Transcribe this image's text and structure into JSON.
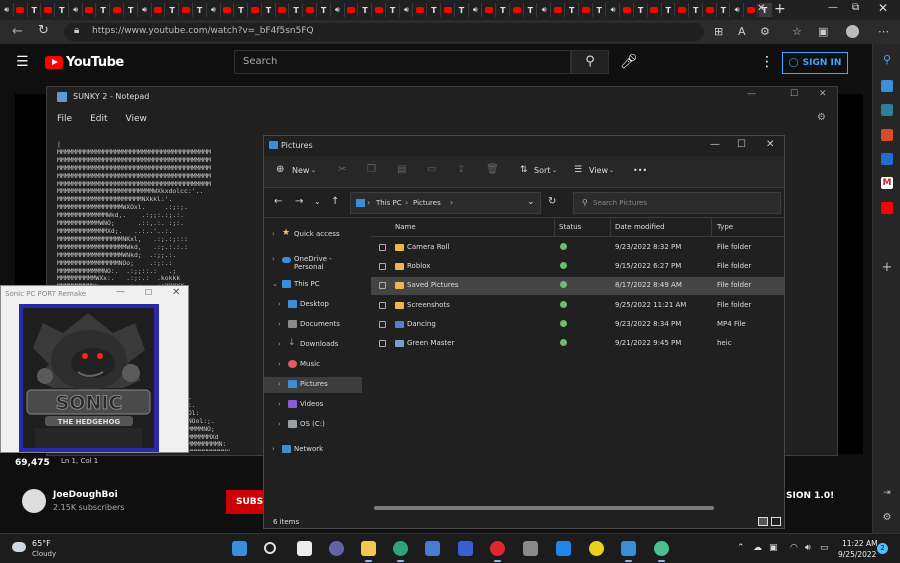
{
  "browser": {
    "tab_close": "✕",
    "url": "https://www.youtube.com/watch?v=_bF4f5sn5FQ"
  },
  "youtube": {
    "logo_text": "YouTube",
    "search_placeholder": "Search",
    "signin_label": "SIGN IN",
    "views": "69,475",
    "channel_name": "JoeDoughBoi",
    "channel_subs": "2.15K subscribers",
    "subscribe_label": "SUBSC",
    "version_text": "SION 1.0!"
  },
  "notepad": {
    "title": "SUNKY 2 - Notepad",
    "menu": [
      "File",
      "Edit",
      "View"
    ],
    "status": "Ln 1, Col 1",
    "content_lines": [
      "|",
      "MMMMMMMMMMMMMMMMMMMMMMMMMMMMMMMMMMMMMMMM",
      "MMMMMMMMMMMMMMMMMMMMMMMMMMMMMMMMMMMMMMMM",
      "MMMMMMMMMMMMMMMMMMMMMMMMMMMMMMMMMMMMMMMM",
      "MMMMMMMMMMMMMMMMMMMMMMMMMMMMMMMMMMMMMMMM",
      "MMMMMMMMMMMMMMMMMMMMMMMMMMMMMMMMMMMMMMMM",
      "MMMMMMMMMMMMMMMMMMMMMMMMMWXkxdolcc:'..",
      "MMMMMMMMMMMMMMMMMMMMMMNXkkl:'.",
      "MMMMMMMMMMMMMMMMMWXOxl.     .:;:;.",
      "MMMMMMMMMMMMMWkd,.    .:;;:.:;.:.",
      "MMMMMMMMMMMWNO;      .::,.:. :;:.",
      "MMMMMMMMMMMMMXd;.   ..:..'..:.",
      "MMMMMMMMMMMMMMMMMNKxl,   .:;.:;:::",
      "MMMMMMMMMMMMMMMMMMWkd,   .:;.:.:.:",
      "MMMMMMMMMMMMMMMMMWNkd;  .:;;.:.",
      "MMMMMMMMMMMMMMMMNOo;    .:;:.:",
      "MMMMMMMMMMMMNO:.  .:;;::.:   .;",
      "MMMMMMMMMMWXx:.   .:;:.:  .kokkk",
      "MMMMMMMMMWx..     .:;:.  .:oXXXXX",
      "MMMMMMMMWk.    .;::;:.  .oOXXXXX",
      "MMMMMMMMMO.   .::;:.    ..oOKXX",
      "MMMMMMMMMMXx.  .:.:.      .oOX",
      "MMMMMMMMMMMNO,  .:;,  ;:.   ..",
      "MMMMMMMMMMMMMWk..:;.:. ..",
      "MMMMMMMMMMMMMMMNx,.:.;.",
      "MMMMMMMMMMMMMMMMMWk:;:;;:",
      "MMMMMMMMMMMMMMMMMMNd:;.:.:",
      "MMMMMMMMMMMMMMMMMMMMNx:.;.",
      "MMMMMMMMMMMMMMMMMMMMMMOl:.:;.",
      "MMMMMMMMMMMMMMMMMMMMMMMNKd;.:",
      "MMMMMMMMMMMMMMMMMMMMMMMMMWXk:.",
      "MMMMMMMMMMMMMMMMMMMMMMMMMMMN0l:.",
      "MMMMMMMMMMMMMMMMMMMMMMMMMMMMMMXd:;.",
      "MMMMMMMMMMMMMMMMMMMMMMMMMMMMMMMXOl:.",
      "MMMMMMMMMMMMMMMMMMMMMMMMMMMMMMMMMNOl:",
      "MMMMMMMMMMMMMMMMMMMMMMMMMMMMMMMMMMNOol:;.",
      "MMMMMMMMMMMMMMMMMMMMMMMMMMMMMMMMMMMMMMNO;",
      "MMMMMMMMMMMMMMMMMMMMMMMMMMMMMMMMMMMMMMMMXd",
      "MMMMMMMMMMMMMMMMMMMMMMMMMMMMMMMMMMMMMMMMMMN:",
      "MMMMMMMMMMMMMMMMMMMMMMMMMMMMMMMMMMMMMMMMMMMMX"
    ]
  },
  "sonic_window": {
    "title": "Sonic PC PORT Remake",
    "logo_text": "SONIC",
    "banner_text": "THE HEDGEHOG"
  },
  "explorer": {
    "title": "Pictures",
    "cmd_new": "New",
    "cmd_sort": "Sort",
    "cmd_view": "View",
    "cmd_more": "•••",
    "crumb_this_pc": "This PC",
    "crumb_pictures": "Pictures",
    "search_placeholder": "Search Pictures",
    "nav": {
      "quick_access": "Quick access",
      "onedrive": "OneDrive - Personal",
      "this_pc": "This PC",
      "desktop": "Desktop",
      "documents": "Documents",
      "downloads": "Downloads",
      "music": "Music",
      "pictures": "Pictures",
      "videos": "Videos",
      "os": "OS (C:)",
      "network": "Network"
    },
    "columns": {
      "name": "Name",
      "status": "Status",
      "date": "Date modified",
      "type": "Type"
    },
    "files": [
      {
        "name": "Camera Roll",
        "date": "9/23/2022 8:32 PM",
        "type": "File folder"
      },
      {
        "name": "Roblox",
        "date": "9/15/2022 6:27 PM",
        "type": "File folder"
      },
      {
        "name": "Saved Pictures",
        "date": "8/17/2022 8:49 AM",
        "type": "File folder"
      },
      {
        "name": "Screenshots",
        "date": "9/25/2022 11:21 AM",
        "type": "File folder"
      },
      {
        "name": "Dancing",
        "date": "9/23/2022 8:34 PM",
        "type": "MP4 File"
      },
      {
        "name": "Green Master",
        "date": "9/21/2022 9:45 PM",
        "type": "heic"
      }
    ],
    "status_count": "6 items"
  },
  "taskbar": {
    "temp": "65°F",
    "weather": "Cloudy",
    "time": "11:22 AM",
    "date": "9/25/2022",
    "notifications": "2"
  }
}
